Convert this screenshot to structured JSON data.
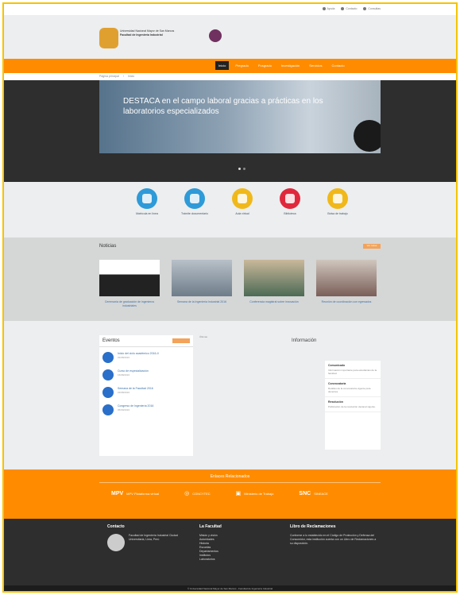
{
  "topbar": {
    "links": [
      "Ayuda",
      "Contacto",
      "Consultas"
    ]
  },
  "header": {
    "logo_text": "Facultad de Ingeniería Industrial",
    "logo_subtext": "Universidad Nacional Mayor de San Marcos"
  },
  "nav": {
    "items": [
      "Inicio",
      "Pregrado",
      "Posgrado",
      "Investigación",
      "Servicios",
      "Contacto"
    ]
  },
  "breadcrumb": [
    "Página principal",
    "Inicio"
  ],
  "hero": {
    "text": "DESTACA en el campo laboral gracias a prácticas en los laboratorios especializados",
    "slides": 2
  },
  "services": [
    {
      "label": "Matrícula en línea",
      "color": "#2e9ad8",
      "icon": "person-icon"
    },
    {
      "label": "Trámite documentario",
      "color": "#2e9ad8",
      "icon": "worker-icon"
    },
    {
      "label": "Aula virtual",
      "color": "#f0b81a",
      "icon": "screen-icon"
    },
    {
      "label": "Biblioteca",
      "color": "#e0283c",
      "icon": "book-icon"
    },
    {
      "label": "Bolsa de trabajo",
      "color": "#f0b81a",
      "icon": "screen-icon"
    }
  ],
  "news": {
    "title": "Noticias",
    "more": "Ver todas",
    "items": [
      "Ceremonia de graduación de ingenieros industriales",
      "Semana de la Ingeniería Industrial 2016",
      "Conferencia magistral sobre innovación",
      "Reunión de coordinación con egresados"
    ]
  },
  "events": {
    "title": "Eventos",
    "more": "Ver todos",
    "items": [
      {
        "title": "Inicio del ciclo académico 2016-II",
        "date": "01/08/2016"
      },
      {
        "title": "Curso de especialización",
        "date": "15/08/2016"
      },
      {
        "title": "Semana de la Facultad 2016",
        "date": "22/08/2016"
      },
      {
        "title": "Congreso de Ingeniería 2016",
        "date": "05/09/2016"
      }
    ]
  },
  "latest_label": "Últimas",
  "info": {
    "title": "Información",
    "items": [
      {
        "h": "Comunicado",
        "p": "Información importante para estudiantes de la facultad."
      },
      {
        "h": "Convocatoria",
        "p": "Detalles de la convocatoria vigente para docentes."
      },
      {
        "h": "Resolución",
        "p": "Publicación de la resolución decanal vigente."
      }
    ]
  },
  "partners": {
    "title": "Enlaces Relacionados",
    "items": [
      "MPV Plataforma virtual",
      "CONCYTEC",
      "Ministerio de Trabajo",
      "SINEACE"
    ]
  },
  "footer": {
    "col1_title": "Contacto",
    "col1_text": "Facultad de Ingeniería Industrial Ciudad Universitaria, Lima, Perú",
    "col2_title": "La Facultad",
    "col2_items": [
      "Misión y visión",
      "Autoridades",
      "Historia",
      "Escuelas",
      "Departamentos",
      "Institutos",
      "Laboratorios"
    ],
    "col3_title": "Libro de Reclamaciones",
    "col3_text": "Conforme a lo establecido en el Código de Protección y Defensa del Consumidor, esta institución cuenta con un Libro de Reclamaciones a su disposición."
  },
  "copyright": "© Universidad Nacional Mayor de San Marcos - Facultad de Ingeniería Industrial"
}
